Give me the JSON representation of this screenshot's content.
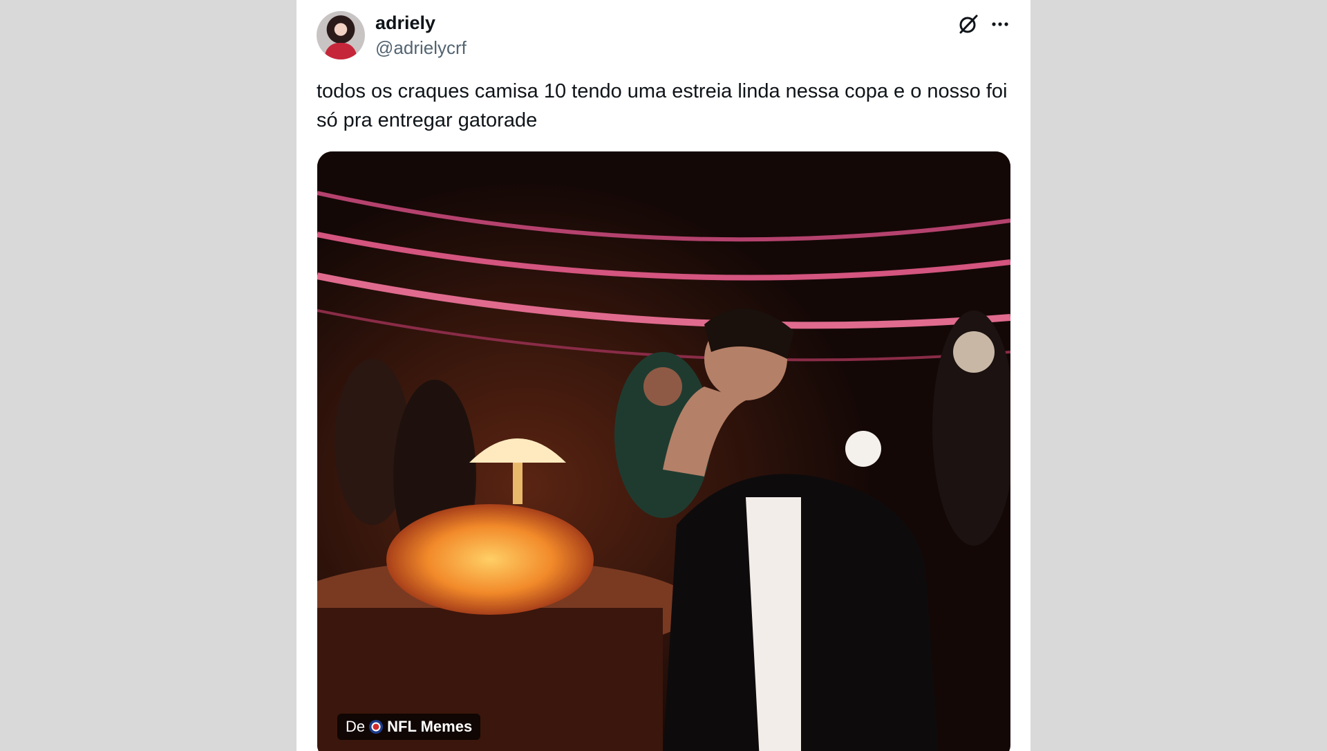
{
  "tweet": {
    "display_name": "adriely",
    "handle": "@adrielycrf",
    "text": "todos os craques camisa 10 tendo uma estreia linda nessa copa e o nosso foi só pra entregar gatorade",
    "icons": {
      "grok": "grok-icon",
      "more": "more-options-icon"
    },
    "media": {
      "source_prefix": "De",
      "source_name": "NFL Memes"
    }
  },
  "colors": {
    "page_background": "#d9d9d9",
    "card_background": "#ffffff",
    "text_primary": "#0f1419",
    "text_secondary": "#536471"
  }
}
